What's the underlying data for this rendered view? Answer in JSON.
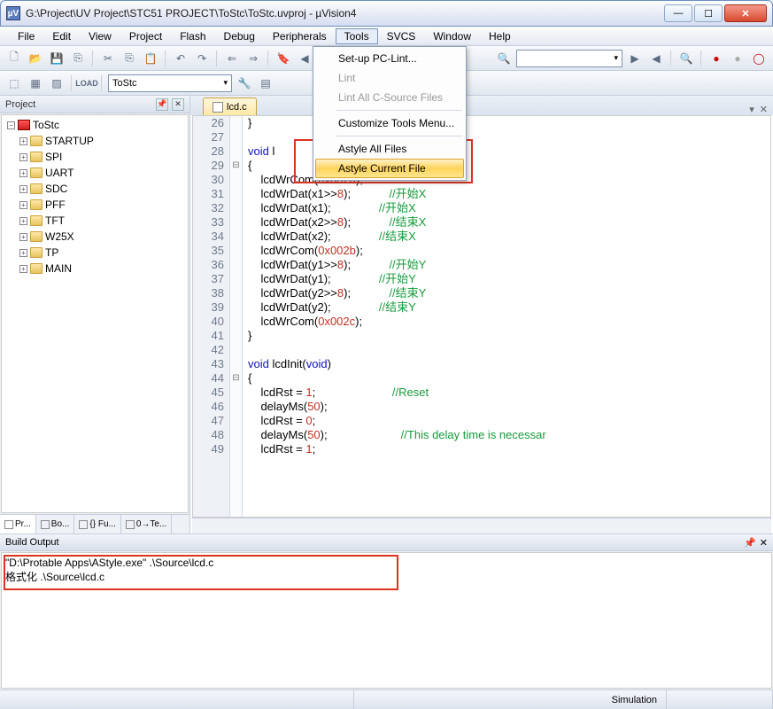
{
  "window": {
    "title": "G:\\Project\\UV Project\\STC51 PROJECT\\ToStc\\ToStc.uvproj - µVision4",
    "app_icon_text": "µV"
  },
  "menu": {
    "items": [
      "File",
      "Edit",
      "View",
      "Project",
      "Flash",
      "Debug",
      "Peripherals",
      "Tools",
      "SVCS",
      "Window",
      "Help"
    ],
    "open_index": 7
  },
  "dropdown": {
    "items": [
      {
        "label": "Set-up PC-Lint..."
      },
      {
        "label": "Lint",
        "disabled": true
      },
      {
        "label": "Lint All C-Source Files",
        "disabled": true
      },
      {
        "sep": true
      },
      {
        "label": "Customize Tools Menu..."
      },
      {
        "sep": true
      },
      {
        "label": "Astyle All Files"
      },
      {
        "label": "Astyle Current File",
        "highlight": true
      }
    ]
  },
  "toolbar2": {
    "target": "ToStc"
  },
  "search_combo": "",
  "project_panel": {
    "title": "Project",
    "root": "ToStc",
    "folders": [
      "STARTUP",
      "SPI",
      "UART",
      "SDC",
      "PFF",
      "TFT",
      "W25X",
      "TP",
      "MAIN"
    ],
    "bottom_tabs": [
      "Pr...",
      "Bo...",
      "{} Fu...",
      "0→Te..."
    ]
  },
  "editor": {
    "active_tab": "lcd.c",
    "lines": [
      {
        "n": 26,
        "fold": "",
        "t": "}"
      },
      {
        "n": 27,
        "fold": "",
        "t": ""
      },
      {
        "n": 28,
        "fold": "",
        "t": "<kw>void</kw> l                         <kw>int</kw> x2,<kw>int</kw> y2)"
      },
      {
        "n": 29,
        "fold": "⊟",
        "t": "{"
      },
      {
        "n": 30,
        "fold": "",
        "t": "    lcdWrCom(<num>0x002a</num>);"
      },
      {
        "n": 31,
        "fold": "",
        "t": "    lcdWrDat(x1>><num>8</num>);            <cm>//开始X</cm>"
      },
      {
        "n": 32,
        "fold": "",
        "t": "    lcdWrDat(x1);               <cm>//开始X</cm>"
      },
      {
        "n": 33,
        "fold": "",
        "t": "    lcdWrDat(x2>><num>8</num>);            <cm>//结束X</cm>"
      },
      {
        "n": 34,
        "fold": "",
        "t": "    lcdWrDat(x2);               <cm>//结束X</cm>"
      },
      {
        "n": 35,
        "fold": "",
        "t": "    lcdWrCom(<num>0x002b</num>);"
      },
      {
        "n": 36,
        "fold": "",
        "t": "    lcdWrDat(y1>><num>8</num>);            <cm>//开始Y</cm>"
      },
      {
        "n": 37,
        "fold": "",
        "t": "    lcdWrDat(y1);               <cm>//开始Y</cm>"
      },
      {
        "n": 38,
        "fold": "",
        "t": "    lcdWrDat(y2>><num>8</num>);            <cm>//结束Y</cm>"
      },
      {
        "n": 39,
        "fold": "",
        "t": "    lcdWrDat(y2);               <cm>//结束Y</cm>"
      },
      {
        "n": 40,
        "fold": "",
        "t": "    lcdWrCom(<num>0x002c</num>);"
      },
      {
        "n": 41,
        "fold": "",
        "t": "}"
      },
      {
        "n": 42,
        "fold": "",
        "t": ""
      },
      {
        "n": 43,
        "fold": "",
        "t": "<kw>void</kw> lcdInit(<kw>void</kw>)"
      },
      {
        "n": 44,
        "fold": "⊟",
        "t": "{"
      },
      {
        "n": 45,
        "fold": "",
        "t": "    lcdRst = <num>1</num>;                        <cm>//Reset</cm>"
      },
      {
        "n": 46,
        "fold": "",
        "t": "    delayMs(<num>50</num>);"
      },
      {
        "n": 47,
        "fold": "",
        "t": "    lcdRst = <num>0</num>;"
      },
      {
        "n": 48,
        "fold": "",
        "t": "    delayMs(<num>50</num>);                       <cm>//This delay time is necessar</cm>"
      },
      {
        "n": 49,
        "fold": "",
        "t": "    lcdRst = <num>1</num>;"
      }
    ]
  },
  "build": {
    "title": "Build Output",
    "line1": "\"D:\\Protable Apps\\AStyle.exe\" .\\Source\\lcd.c",
    "line2": "格式化  .\\Source\\lcd.c"
  },
  "status": {
    "right": "Simulation"
  }
}
